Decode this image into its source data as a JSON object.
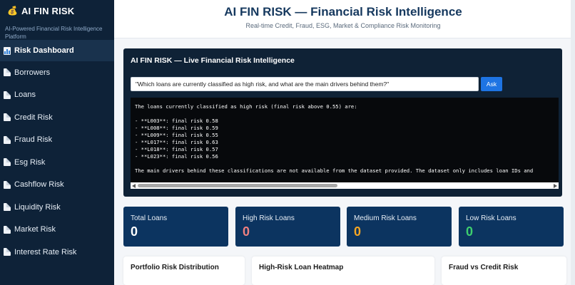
{
  "sidebar": {
    "brand_icon": "💰",
    "title": "AI FIN RISK",
    "subtitle": "AI-Powered Financial Risk Intelligence Platform",
    "items": [
      {
        "label": "Risk Dashboard",
        "icon": "bar-chart-icon",
        "active": true
      },
      {
        "label": "Borrowers",
        "icon": "document-icon"
      },
      {
        "label": "Loans",
        "icon": "document-icon"
      },
      {
        "label": "Credit Risk",
        "icon": "document-icon"
      },
      {
        "label": "Fraud Risk",
        "icon": "document-icon"
      },
      {
        "label": "Esg Risk",
        "icon": "document-icon"
      },
      {
        "label": "Cashflow Risk",
        "icon": "document-icon"
      },
      {
        "label": "Liquidity Risk",
        "icon": "document-icon"
      },
      {
        "label": "Market Risk",
        "icon": "document-icon"
      },
      {
        "label": "Interest Rate Risk",
        "icon": "document-icon"
      }
    ]
  },
  "header": {
    "title": "AI FIN RISK — Financial Risk Intelligence",
    "subtitle": "Real-time Credit, Fraud, ESG, Market & Compliance Risk Monitoring"
  },
  "assistant": {
    "title": "AI FIN RISK — Live Financial Risk Intelligence",
    "question": "\"Which loans are currently classified as high risk, and what are the main drivers behind them?\"",
    "ask_label": "Ask",
    "answer_lines": [
      "The loans currently classified as high risk (final risk above 0.55) are:",
      "",
      "- **L003**: final risk 0.58",
      "- **L008**: final risk 0.59",
      "- **L009**: final risk 0.55",
      "- **L017**: final risk 0.63",
      "- **L018**: final risk 0.57",
      "- **L023**: final risk 0.56",
      "",
      "The main drivers behind these classifications are not available from the dataset provided. The dataset only includes loan IDs and"
    ]
  },
  "kpis": [
    {
      "label": "Total Loans",
      "value": "0",
      "color": "#ffffff"
    },
    {
      "label": "High Risk Loans",
      "value": "0",
      "color": "#f08080"
    },
    {
      "label": "Medium Risk Loans",
      "value": "0",
      "color": "#f5a623"
    },
    {
      "label": "Low Risk Loans",
      "value": "0",
      "color": "#3ecf6e"
    }
  ],
  "charts": [
    {
      "title": "Portfolio Risk Distribution"
    },
    {
      "title": "High-Risk Loan Heatmap"
    },
    {
      "title": "Fraud vs Credit Risk"
    }
  ],
  "colors": {
    "sidebar_bg": "#0e2238",
    "panel_bg": "#0f2236",
    "card_bg": "#0c3460",
    "accent": "#1e74e3",
    "title": "#15385e"
  }
}
